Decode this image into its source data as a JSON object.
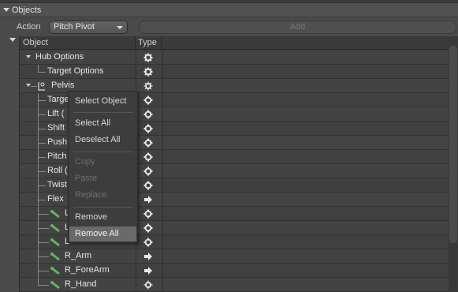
{
  "panel": {
    "title": "Objects"
  },
  "action": {
    "label": "Action",
    "selected": "Pitch Pivot",
    "add_label": "Add"
  },
  "columns": {
    "object": "Object",
    "type": "Type"
  },
  "rows": [
    {
      "label": "Hub Options",
      "type_icon": "gear-icon"
    },
    {
      "label": "Target Options",
      "type_icon": "gear-icon"
    },
    {
      "label": "Pelvis",
      "type_icon": "joint-gear-icon"
    },
    {
      "label": "Target",
      "type_icon": "gear-icon"
    },
    {
      "label": "Lift (",
      "type_icon": "gear-icon"
    },
    {
      "label": "Shift",
      "type_icon": "gear-icon"
    },
    {
      "label": "Push",
      "type_icon": "gear-icon"
    },
    {
      "label": "Pitch",
      "type_icon": "gear-icon"
    },
    {
      "label": "Roll (",
      "type_icon": "gear-icon"
    },
    {
      "label": "Twist",
      "type_icon": "gear-icon"
    },
    {
      "label": "Flex",
      "type_icon": "arrow-icon"
    },
    {
      "label": "L",
      "type_icon": "gear-icon"
    },
    {
      "label": "L",
      "type_icon": "gear-icon"
    },
    {
      "label": "L",
      "type_icon": "gear-icon"
    },
    {
      "label": "R_Arm",
      "type_icon": "arrow-icon"
    },
    {
      "label": "R_ForeArm",
      "type_icon": "arrow-icon"
    },
    {
      "label": "R_Hand",
      "type_icon": "gear-icon"
    }
  ],
  "context_menu": {
    "items": [
      {
        "label": "Select Object",
        "enabled": true
      },
      {
        "label": "Select All",
        "enabled": true
      },
      {
        "label": "Deselect All",
        "enabled": true
      },
      {
        "label": "Copy",
        "enabled": false
      },
      {
        "label": "Paste",
        "enabled": false
      },
      {
        "label": "Replace",
        "enabled": false
      },
      {
        "label": "Remove",
        "enabled": true
      },
      {
        "label": "Remove All",
        "enabled": true,
        "highlighted": true
      }
    ]
  },
  "colors": {
    "panel_bg": "#4a4a4a",
    "list_bg": "#3e3e3e",
    "menu_highlight": "#6a6a6a",
    "bone_green": "#5fb85a"
  }
}
